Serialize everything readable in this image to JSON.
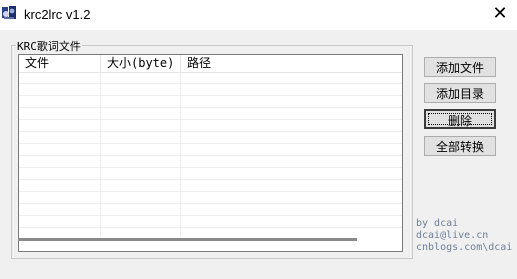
{
  "window": {
    "title": "krc2lrc v1.2",
    "close_glyph": "✕",
    "icon": "app-icon"
  },
  "groupbox": {
    "label": "KRC歌词文件"
  },
  "listview": {
    "columns": [
      "文件",
      "大小(byte)",
      "路径"
    ],
    "rows": []
  },
  "buttons": {
    "add_file": "添加文件",
    "add_dir": "添加目录",
    "delete": "删除",
    "convert_all": "全部转换"
  },
  "credits": [
    "by dcai",
    "dcai@live.cn",
    "cnblogs.com\\dcai"
  ],
  "colors": {
    "credits": "#6d7f99",
    "window_bg": "#f0f0f0"
  }
}
